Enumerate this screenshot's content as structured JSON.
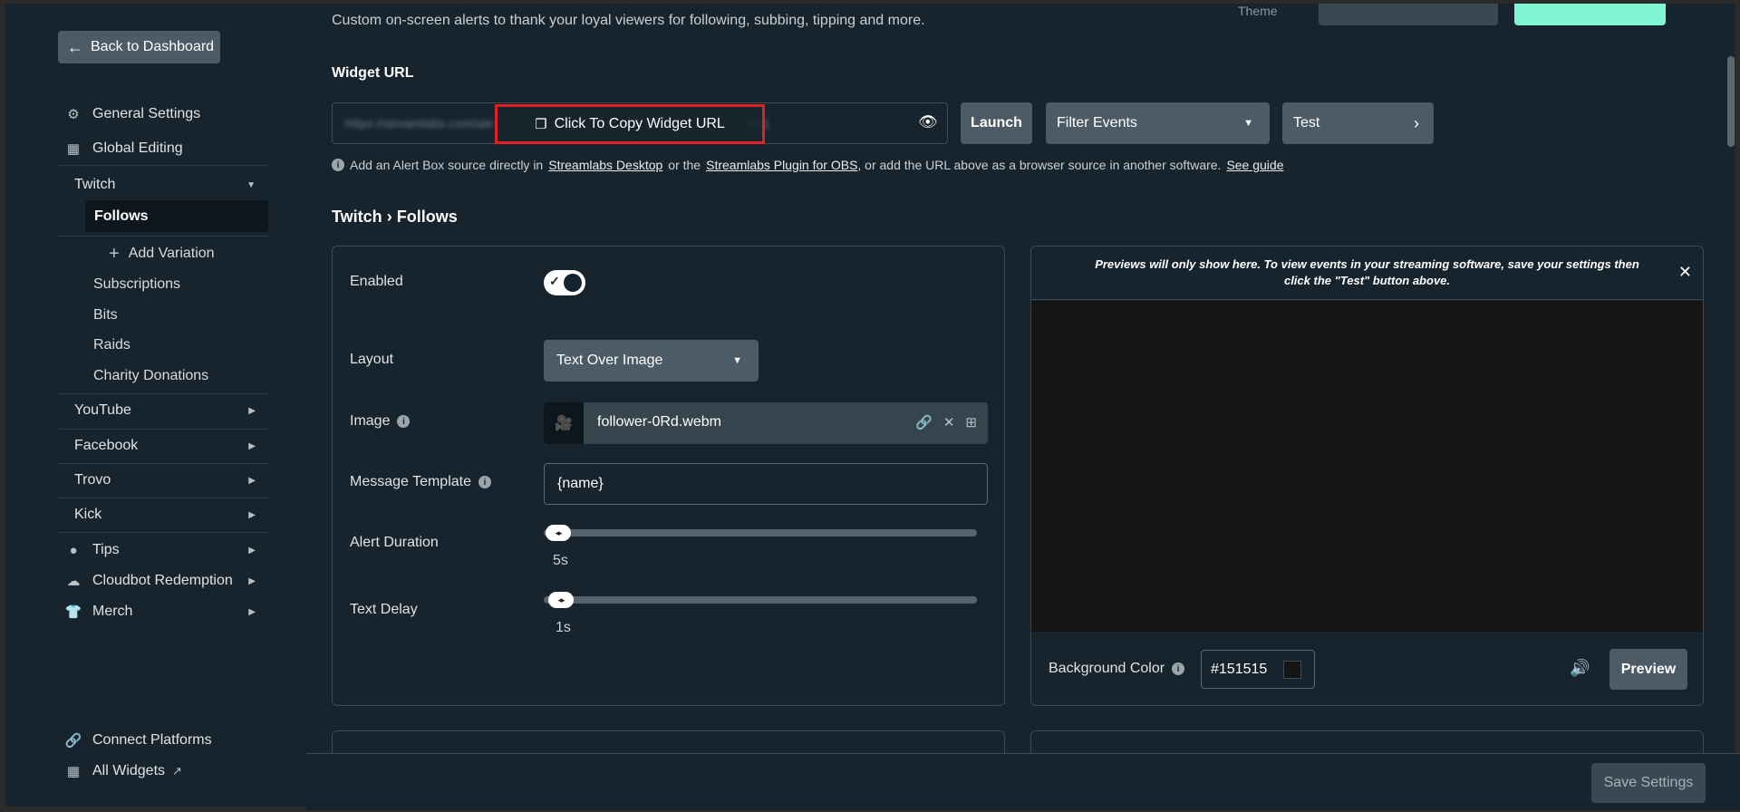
{
  "header": {
    "subtitle": "Custom on-screen alerts to thank your loyal viewers for following, subbing, tipping and more.",
    "theme_label": "Theme"
  },
  "sidebar": {
    "back_label": "Back to Dashboard",
    "general_settings": "General Settings",
    "global_editing": "Global Editing",
    "twitch": "Twitch",
    "follows": "Follows",
    "add_variation": "Add Variation",
    "subscriptions": "Subscriptions",
    "bits": "Bits",
    "raids": "Raids",
    "charity_donations": "Charity Donations",
    "youtube": "YouTube",
    "facebook": "Facebook",
    "trovo": "Trovo",
    "kick": "Kick",
    "tips": "Tips",
    "cloudbot": "Cloudbot Redemption",
    "merch": "Merch",
    "connect_platforms": "Connect Platforms",
    "all_widgets": "All Widgets"
  },
  "widget_url": {
    "label": "Widget URL",
    "blurred_start": "https://streamlabs.com/ale",
    "blurred_end": "fd61",
    "copy_label": "Click To Copy Widget URL",
    "launch_label": "Launch",
    "filter_label": "Filter Events",
    "test_label": "Test",
    "info_prefix": "Add an Alert Box source directly in",
    "link_desktop": "Streamlabs Desktop",
    "info_mid": "or the",
    "link_obs": "Streamlabs Plugin for OBS",
    "info_suffix": ", or add the URL above as a browser source in another software.",
    "link_guide": "See guide"
  },
  "breadcrumb": {
    "platform": "Twitch",
    "sep": "›",
    "page": "Follows"
  },
  "settings": {
    "enabled_label": "Enabled",
    "enabled": true,
    "layout_label": "Layout",
    "layout_value": "Text Over Image",
    "image_label": "Image",
    "image_file": "follower-0Rd.webm",
    "message_label": "Message Template",
    "message_value": "{name}",
    "duration_label": "Alert Duration",
    "duration_value": "5s",
    "delay_label": "Text Delay",
    "delay_value": "1s"
  },
  "preview": {
    "notice": "Previews will only show here. To view events in your streaming software, save your settings then click the \"Test\" button above.",
    "bg_label": "Background Color",
    "bg_value": "#151515",
    "preview_btn": "Preview"
  },
  "footer": {
    "save_label": "Save Settings"
  },
  "colors": {
    "accent": "#80f5d2",
    "highlight_box": "#e02027",
    "background": "#17242d"
  }
}
